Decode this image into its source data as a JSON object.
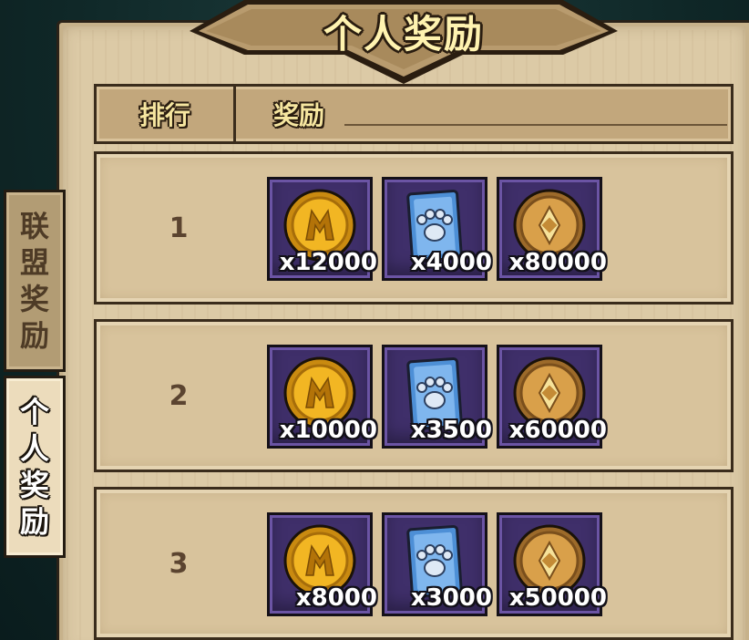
{
  "window": {
    "title": "个人奖励"
  },
  "side_tabs": [
    {
      "label_chars": [
        "联",
        "盟",
        "奖",
        "励"
      ],
      "active": false
    },
    {
      "label_chars": [
        "个",
        "人",
        "奖",
        "励"
      ],
      "active": true
    }
  ],
  "table": {
    "headers": {
      "rank": "排行",
      "reward": "奖励"
    },
    "rows": [
      {
        "rank": "1",
        "rewards": [
          {
            "icon": "gold-coin-icon",
            "quantity": "x12000"
          },
          {
            "icon": "paw-card-icon",
            "quantity": "x4000"
          },
          {
            "icon": "bronze-coin-icon",
            "quantity": "x80000"
          }
        ]
      },
      {
        "rank": "2",
        "rewards": [
          {
            "icon": "gold-coin-icon",
            "quantity": "x10000"
          },
          {
            "icon": "paw-card-icon",
            "quantity": "x3500"
          },
          {
            "icon": "bronze-coin-icon",
            "quantity": "x60000"
          }
        ]
      },
      {
        "rank": "3",
        "rewards": [
          {
            "icon": "gold-coin-icon",
            "quantity": "x8000"
          },
          {
            "icon": "paw-card-icon",
            "quantity": "x3000"
          },
          {
            "icon": "bronze-coin-icon",
            "quantity": "x50000"
          }
        ]
      }
    ]
  },
  "colors": {
    "parchment": "#dccaa6",
    "item_bg": "#3f2f6a",
    "title_text": "#fff3b0",
    "outline": "#2a1d10"
  }
}
